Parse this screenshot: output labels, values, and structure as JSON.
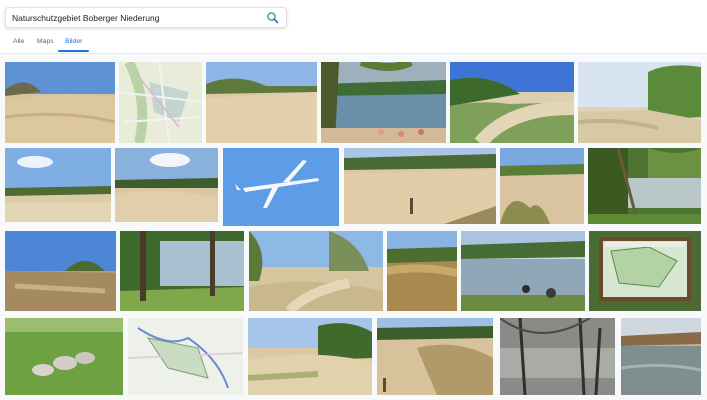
{
  "search": {
    "query": "Naturschutzgebiet Boberger Niederung",
    "icon": "search-icon"
  },
  "tabs": [
    {
      "label": "Alle",
      "active": false
    },
    {
      "label": "Maps",
      "active": false
    },
    {
      "label": "Bilder",
      "active": true
    }
  ],
  "colors": {
    "accent": "#1a73e8",
    "background": "#f8f9fa"
  }
}
